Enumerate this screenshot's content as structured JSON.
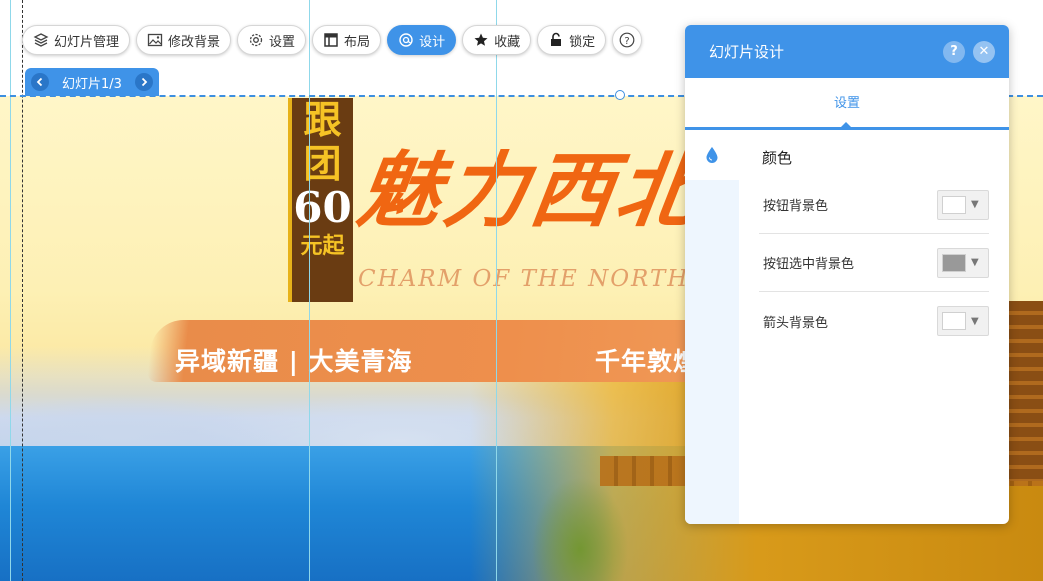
{
  "toolbar": {
    "items": [
      {
        "id": "slides",
        "label": "幻灯片管理",
        "icon": "layers-icon"
      },
      {
        "id": "background",
        "label": "修改背景",
        "icon": "image-icon"
      },
      {
        "id": "settings",
        "label": "设置",
        "icon": "gear-icon"
      },
      {
        "id": "layout",
        "label": "布局",
        "icon": "layout-icon"
      },
      {
        "id": "design",
        "label": "设计",
        "icon": "palette-icon",
        "active": true
      },
      {
        "id": "favorite",
        "label": "收藏",
        "icon": "star-icon"
      },
      {
        "id": "lock",
        "label": "锁定",
        "icon": "lock-icon"
      }
    ],
    "help_label": "?"
  },
  "slide_tab": {
    "label": "幻灯片1/3"
  },
  "banner": {
    "promo": {
      "c1": "跟",
      "c2": "团",
      "num": "60",
      "sub": "元起"
    },
    "main_title": "魅力西北",
    "en_title": "CHARM OF THE NORTHWEST",
    "subtitle_left": "异域新疆 | 大美青海",
    "subtitle_right": "千年敦煌"
  },
  "panel": {
    "title": "幻灯片设计",
    "help_label": "?",
    "close_label": "✕",
    "tab_label": "设置",
    "section_title": "颜色",
    "rows": [
      {
        "label": "按钮背景色",
        "color": "#ffffff"
      },
      {
        "label": "按钮选中背景色",
        "color": "#999999"
      },
      {
        "label": "箭头背景色",
        "color": "#ffffff"
      }
    ],
    "picker_arrow": "▼"
  },
  "colors": {
    "accent": "#3f93e8",
    "title_orange": "#f06612"
  }
}
